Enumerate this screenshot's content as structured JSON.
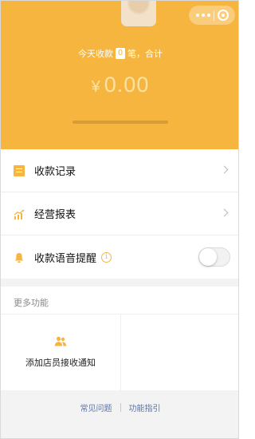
{
  "header": {
    "today_prefix": "今天收款",
    "count": "0",
    "today_suffix": "笔，合计",
    "currency": "¥",
    "amount": "0.00"
  },
  "menu": {
    "items": [
      {
        "label": "收款记录",
        "icon": "document-icon"
      },
      {
        "label": "经营报表",
        "icon": "chart-icon"
      },
      {
        "label": "收款语音提醒",
        "icon": "bell-icon",
        "info": "i",
        "toggle": false
      }
    ]
  },
  "more": {
    "title": "更多功能",
    "functions": [
      {
        "label": "添加店员接收通知",
        "icon": "staff-icon"
      }
    ]
  },
  "footer": {
    "faq": "常见问题",
    "guide": "功能指引"
  },
  "colors": {
    "accent": "#f6b53f",
    "link": "#5a74a8"
  }
}
